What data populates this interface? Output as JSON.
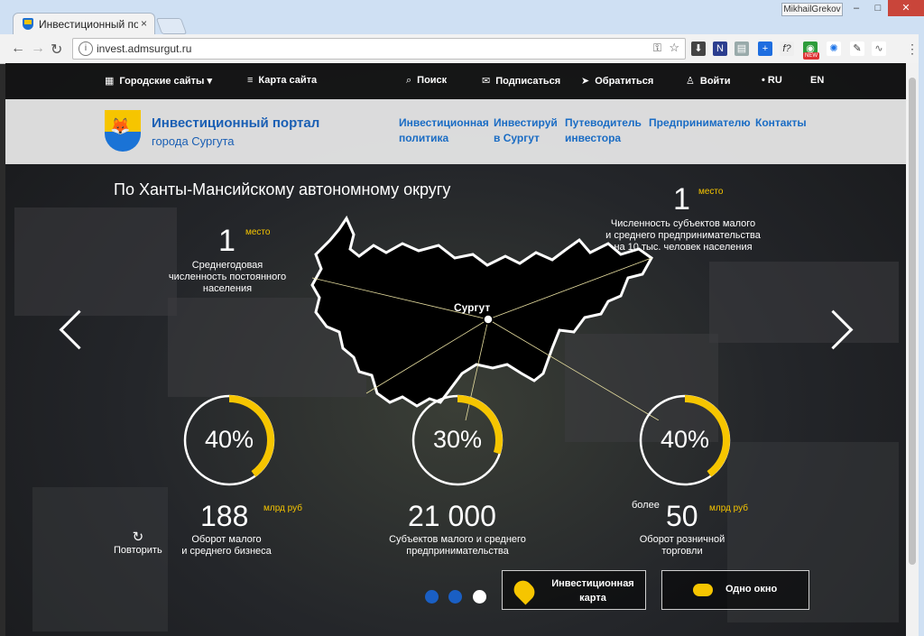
{
  "browser": {
    "tab_title": "Инвестиционный порта",
    "tab_close": "×",
    "user_badge": "MikhailGrekov",
    "url": "invest.admsurgut.ru",
    "win_min": "–",
    "win_max": "□",
    "win_close": "✕",
    "ext_new_badge": "NEW"
  },
  "topnav": {
    "city_sites": "Городские сайты",
    "sitemap": "Карта сайта",
    "search": "Поиск",
    "subscribe": "Подписаться",
    "contact": "Обратиться",
    "login": "Войти",
    "lang_ru": "• RU",
    "lang_en": "EN"
  },
  "header": {
    "title": "Инвестиционный портал",
    "subtitle": "города Сургута",
    "menu": [
      {
        "line1": "Инвестиционная",
        "line2": "политика"
      },
      {
        "line1": "Инвестируй",
        "line2": "в Сургут"
      },
      {
        "line1": "Путеводитель",
        "line2": "инвестора"
      },
      {
        "line1": "Предпринимателю",
        "line2": ""
      },
      {
        "line1": "Контакты",
        "line2": ""
      }
    ]
  },
  "slide": {
    "region_title": "По Ханты-Мансийскому автономному округу",
    "city_label": "Сургут",
    "rank_left": {
      "value": "1",
      "unit": "место",
      "desc1": "Среднегодовая",
      "desc2": "численность постоянного",
      "desc3": "населения"
    },
    "rank_right": {
      "value": "1",
      "unit": "место",
      "desc1": "Численность субъектов малого",
      "desc2": "и среднего предпринимательства",
      "desc3": "на 10 тыс. человек населения"
    },
    "gauges": [
      {
        "pct": "40%",
        "fraction": 0.4,
        "value": "188",
        "unit": "млрд руб",
        "prefix": "",
        "cap1": "Оборот малого",
        "cap2": "и среднего бизнеса"
      },
      {
        "pct": "30%",
        "fraction": 0.3,
        "value": "21 000",
        "unit": "",
        "prefix": "",
        "cap1": "Субъектов малого и среднего",
        "cap2": "предпринимательства"
      },
      {
        "pct": "40%",
        "fraction": 0.4,
        "value": "50",
        "unit": "млрд руб",
        "prefix": "более",
        "cap1": "Оборот розничной",
        "cap2": "торговли"
      }
    ],
    "repeat_label": "Повторить",
    "cta_map_1": "Инвестиционная",
    "cta_map_2": "карта",
    "cta_window": "Одно окно"
  },
  "colors": {
    "accent": "#f6c500",
    "link": "#1a6cc4",
    "dot_active": "#ffffff",
    "dot_inactive": "#1a5fc4"
  }
}
